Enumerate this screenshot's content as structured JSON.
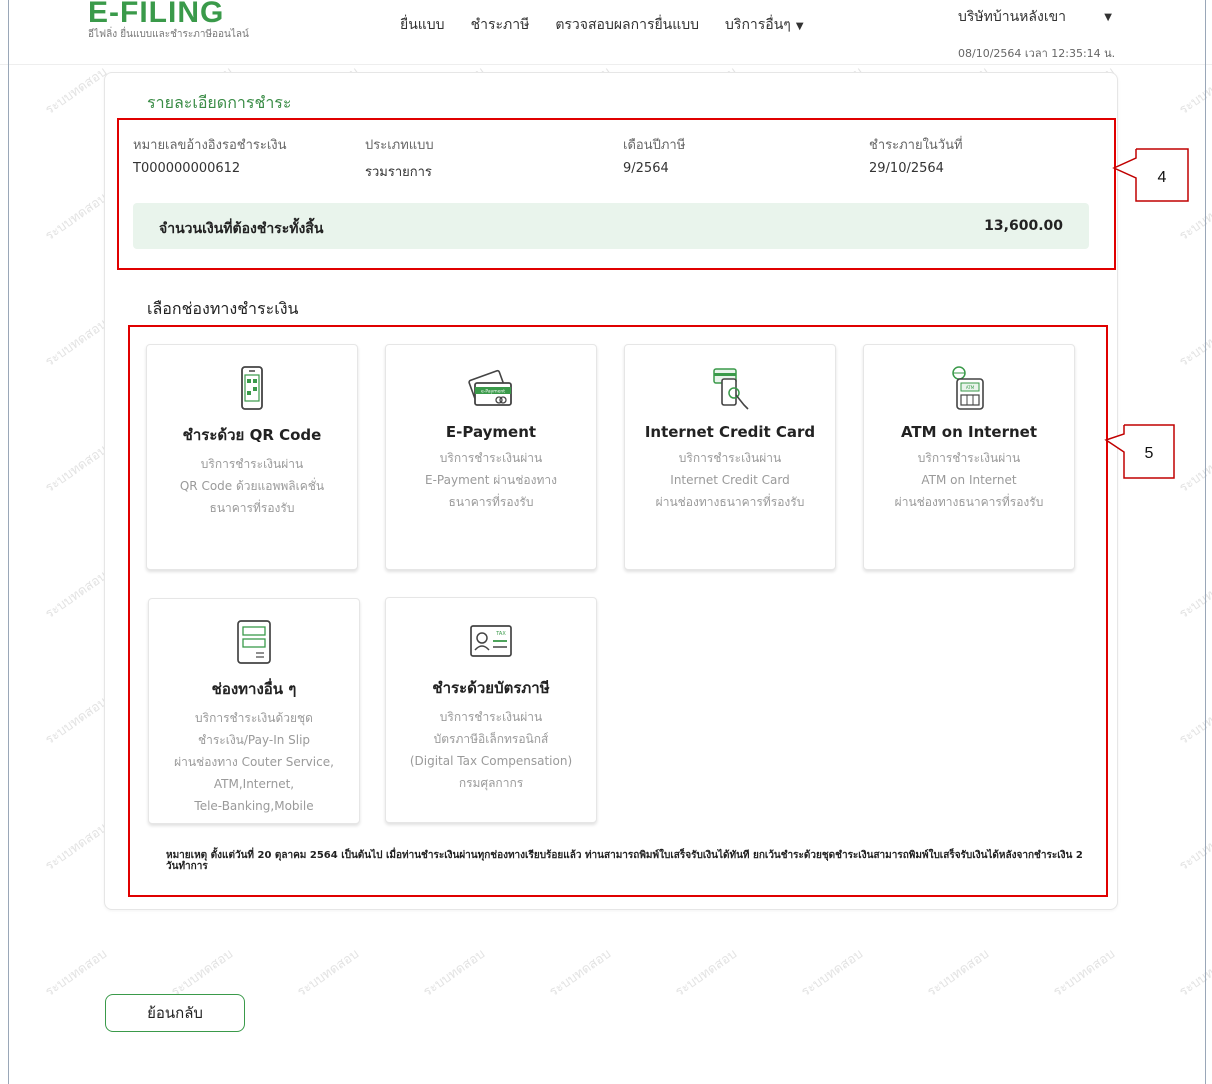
{
  "header": {
    "logo_text": "E-FILING",
    "logo_subtitle": "อีไฟลิ่ง ยื่นแบบและชำระภาษีออนไลน์",
    "nav": [
      {
        "label": "ยื่นแบบ"
      },
      {
        "label": "ชำระภาษี"
      },
      {
        "label": "ตรวจสอบผลการยื่นแบบ"
      },
      {
        "label": "บริการอื่นๆ"
      }
    ],
    "user_name": "บริษัทบ้านหลังเขา",
    "datetime": "08/10/2564 เวลา 12:35:14 น."
  },
  "payment_details": {
    "title": "รายละเอียดการชำระ",
    "fields": [
      {
        "label": "หมายเลขอ้างอิงรอชำระเงิน",
        "value": "T000000000612"
      },
      {
        "label": "ประเภทแบบ",
        "value": "รวมรายการ"
      },
      {
        "label": "เดือนปีภาษี",
        "value": "9/2564"
      },
      {
        "label": "ชำระภายในวันที่",
        "value": "29/10/2564"
      }
    ],
    "total_label": "จำนวนเงินที่ต้องชำระทั้งสิ้น",
    "total_value": "13,600.00"
  },
  "channels": {
    "title": "เลือกช่องทางชำระเงิน",
    "items": [
      {
        "title": "ชำระด้วย QR Code",
        "desc": [
          "บริการชำระเงินผ่าน",
          "QR Code ด้วยแอพพลิเคชั่น",
          "ธนาคารที่รองรับ"
        ],
        "icon": "qr-phone-icon"
      },
      {
        "title": "E-Payment",
        "desc": [
          "บริการชำระเงินผ่าน",
          "E-Payment ผ่านช่องทาง",
          "ธนาคารที่รองรับ"
        ],
        "icon": "e-payment-card-icon",
        "icon_text": "e-Payment"
      },
      {
        "title": "Internet Credit Card",
        "desc": [
          "บริการชำระเงินผ่าน",
          "Internet Credit Card",
          "ผ่านช่องทางธนาคารที่รองรับ"
        ],
        "icon": "credit-card-hand-icon"
      },
      {
        "title": "ATM on Internet",
        "desc": [
          "บริการชำระเงินผ่าน",
          "ATM on Internet",
          "ผ่านช่องทางธนาคารที่รองรับ"
        ],
        "icon": "atm-machine-icon",
        "icon_text": "ATM"
      },
      {
        "title": "ช่องทางอื่น ๆ",
        "desc": [
          "บริการชำระเงินด้วยชุด",
          "ชำระเงิน/Pay-In Slip",
          "ผ่านช่องทาง Couter Service,",
          "ATM,Internet,",
          "Tele-Banking,Mobile"
        ],
        "icon": "pay-in-slip-icon"
      },
      {
        "title": "ชำระด้วยบัตรภาษี",
        "desc": [
          "บริการชำระเงินผ่าน",
          "บัตรภาษีอิเล็กทรอนิกส์",
          "(Digital Tax Compensation)",
          "กรมศุลกากร"
        ],
        "icon": "tax-card-icon",
        "icon_text": "TAX"
      }
    ]
  },
  "remark": "หมายเหตุ ตั้งแต่วันที่ 20 ตุลาคม 2564 เป็นต้นไป เมื่อท่านชำระเงินผ่านทุกช่องทางเรียบร้อยแล้ว ท่านสามารถพิมพ์ใบเสร็จรับเงินได้ทันที ยกเว้นชำระด้วยชุดชำระเงินสามารถพิมพ์ใบเสร็จรับเงินได้หลังจากชำระเงิน 2 วันทำการ",
  "back_button": "ย้อนกลับ",
  "annotations": [
    "4",
    "5"
  ],
  "watermark_text": "ระบบทดสอบ",
  "colors": {
    "brand_green": "#3a9a4a",
    "annotation_red": "#e00000",
    "total_bg": "#e9f4ec"
  }
}
